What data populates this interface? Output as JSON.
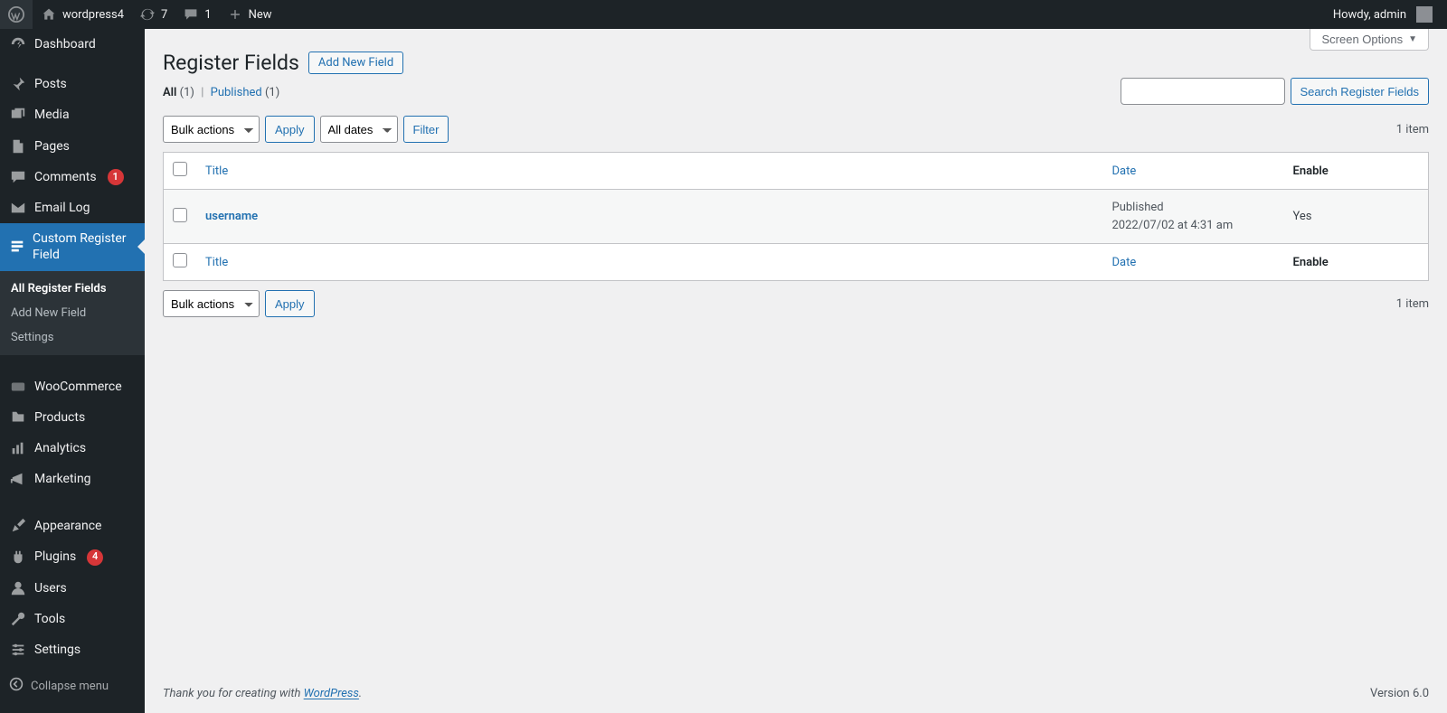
{
  "adminbar": {
    "site_name": "wordpress4",
    "updates_count": "7",
    "comments_count": "1",
    "new_label": "New",
    "howdy": "Howdy, admin"
  },
  "sidebar": {
    "items": [
      {
        "key": "dashboard",
        "label": "Dashboard"
      },
      {
        "key": "posts",
        "label": "Posts"
      },
      {
        "key": "media",
        "label": "Media"
      },
      {
        "key": "pages",
        "label": "Pages"
      },
      {
        "key": "comments",
        "label": "Comments",
        "badge": "1"
      },
      {
        "key": "email-log",
        "label": "Email Log"
      },
      {
        "key": "custom-register-field",
        "label": "Custom Register Field",
        "current": true,
        "submenu": [
          {
            "label": "All Register Fields",
            "current": true
          },
          {
            "label": "Add New Field"
          },
          {
            "label": "Settings"
          }
        ]
      },
      {
        "key": "woocommerce",
        "label": "WooCommerce"
      },
      {
        "key": "products",
        "label": "Products"
      },
      {
        "key": "analytics",
        "label": "Analytics"
      },
      {
        "key": "marketing",
        "label": "Marketing"
      },
      {
        "key": "appearance",
        "label": "Appearance"
      },
      {
        "key": "plugins",
        "label": "Plugins",
        "badge": "4"
      },
      {
        "key": "users",
        "label": "Users"
      },
      {
        "key": "tools",
        "label": "Tools"
      },
      {
        "key": "settings",
        "label": "Settings"
      }
    ],
    "collapse_label": "Collapse menu"
  },
  "screen_options": {
    "label": "Screen Options"
  },
  "page": {
    "title": "Register Fields",
    "add_new_label": "Add New Field"
  },
  "views": {
    "all": {
      "label": "All",
      "count": "(1)"
    },
    "published": {
      "label": "Published",
      "count": "(1)"
    }
  },
  "search": {
    "button_label": "Search Register Fields"
  },
  "bulk": {
    "placeholder": "Bulk actions",
    "apply_label": "Apply",
    "dates_placeholder": "All dates",
    "filter_label": "Filter"
  },
  "pagination": {
    "count_text": "1 item"
  },
  "table": {
    "columns": {
      "title": "Title",
      "date": "Date",
      "enable": "Enable"
    },
    "rows": [
      {
        "title": "username",
        "date_status": "Published",
        "date_text": "2022/07/02 at 4:31 am",
        "enable": "Yes"
      }
    ]
  },
  "footer": {
    "thanks_pre": "Thank you for creating with ",
    "thanks_link": "WordPress",
    "thanks_suffix": ".",
    "version": "Version 6.0"
  }
}
